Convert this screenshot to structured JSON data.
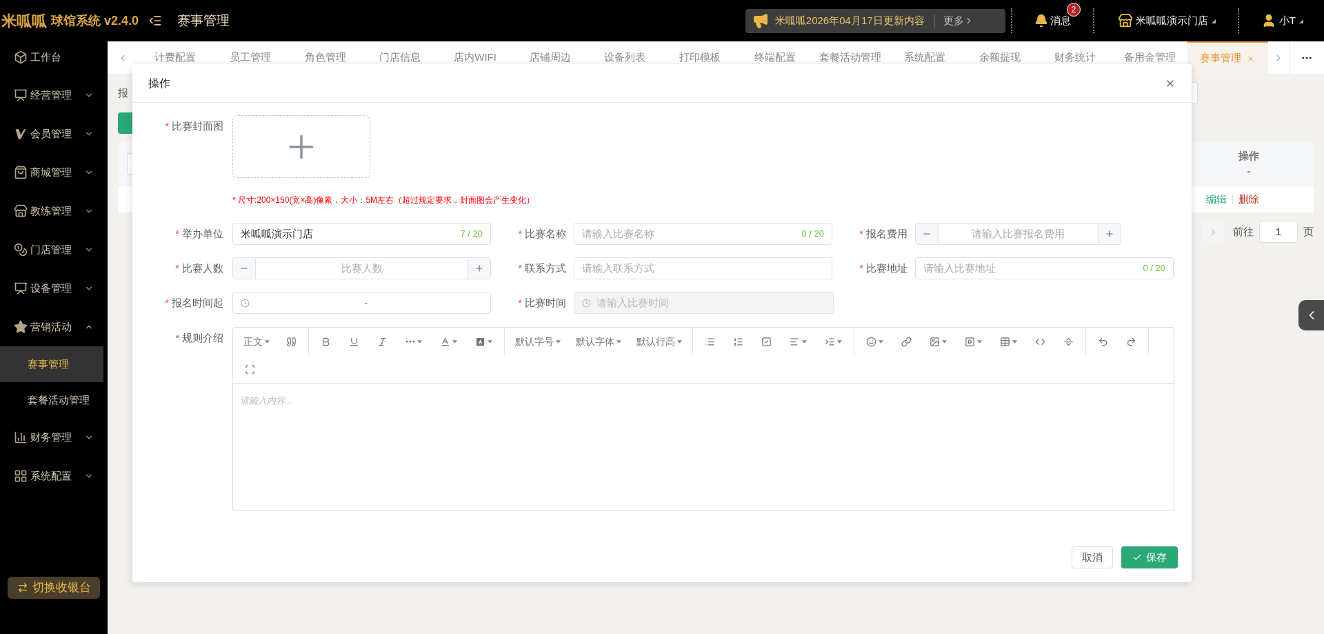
{
  "topbar": {
    "logo": "米呱呱",
    "app_name": "球馆系统 v2.4.0",
    "page_title": "赛事管理",
    "notice": {
      "text": "米呱呱2026年04月17日更新内容",
      "more": "更多"
    },
    "messages": {
      "label": "消息",
      "badge": "2"
    },
    "store": "米呱呱演示门店",
    "user": "小T"
  },
  "sidebar": {
    "items": [
      {
        "label": "工作台",
        "kind": "link",
        "selected": false
      },
      {
        "label": "经营管理",
        "kind": "group",
        "expanded": false
      },
      {
        "label": "会员管理",
        "kind": "group",
        "expanded": false
      },
      {
        "label": "商城管理",
        "kind": "group",
        "expanded": false
      },
      {
        "label": "教练管理",
        "kind": "group",
        "expanded": false
      },
      {
        "label": "门店管理",
        "kind": "group",
        "expanded": false
      },
      {
        "label": "设备管理",
        "kind": "group",
        "expanded": false
      },
      {
        "label": "营销活动",
        "kind": "group",
        "expanded": true,
        "children": [
          {
            "label": "赛事管理",
            "selected": true
          },
          {
            "label": "套餐活动管理",
            "selected": false
          }
        ]
      },
      {
        "label": "财务管理",
        "kind": "group",
        "expanded": false
      },
      {
        "label": "系统配置",
        "kind": "group",
        "expanded": false
      }
    ],
    "switch_button": "切换收银台"
  },
  "tabs": [
    {
      "label": "计费配置",
      "selected": false
    },
    {
      "label": "员工管理",
      "selected": false
    },
    {
      "label": "角色管理",
      "selected": false
    },
    {
      "label": "门店信息",
      "selected": false
    },
    {
      "label": "店内WIFI",
      "selected": false
    },
    {
      "label": "店铺周边",
      "selected": false
    },
    {
      "label": "设备列表",
      "selected": false
    },
    {
      "label": "打印模板",
      "selected": false
    },
    {
      "label": "终端配置",
      "selected": false
    },
    {
      "label": "套餐活动管理",
      "selected": false
    },
    {
      "label": "系统配置",
      "selected": false
    },
    {
      "label": "余额提现",
      "selected": false
    },
    {
      "label": "财务统计",
      "selected": false
    },
    {
      "label": "备用金管理",
      "selected": false
    },
    {
      "label": "赛事管理",
      "selected": true
    }
  ],
  "background": {
    "filter_label": "报",
    "table": {
      "column_title": "操作",
      "column_subtitle": "-",
      "actions": [
        {
          "label": "编辑",
          "color": "#2aa876"
        },
        {
          "label": "删除",
          "color": "#c0392b"
        }
      ]
    },
    "pagination": {
      "goto_label": "前往",
      "page": "1",
      "page_suffix": "页"
    }
  },
  "dialog": {
    "title": "操作",
    "required_mark": "*",
    "cover": {
      "label": "比赛封面图",
      "required": true,
      "hint": "* 尺寸:200×150(宽×高)像素，大小：5M左右（超过规定要求，封面图会产生变化）"
    },
    "field_rows": [
      [
        {
          "label": "举办单位",
          "required": true,
          "kind": "text",
          "value": "米呱呱演示门店",
          "counter": "7 / 20",
          "disabled": false
        },
        {
          "label": "比赛名称",
          "required": true,
          "kind": "text",
          "placeholder": "请输入比赛名称",
          "counter": "0 / 20",
          "disabled": false
        },
        {
          "label": "报名费用",
          "required": true,
          "kind": "number",
          "placeholder": "请输入比赛报名费用",
          "disabled": false
        }
      ],
      [
        {
          "label": "比赛人数",
          "required": true,
          "kind": "number",
          "placeholder": "比赛人数",
          "disabled": false
        },
        {
          "label": "联系方式",
          "required": true,
          "kind": "text",
          "placeholder": "请输入联系方式",
          "disabled": false
        },
        {
          "label": "比赛地址",
          "required": true,
          "kind": "text",
          "placeholder": "请输入比赛地址",
          "counter": "0 / 20",
          "disabled": false
        }
      ],
      [
        {
          "label": "报名时间起",
          "required": true,
          "kind": "daterange",
          "separator": "-",
          "disabled": false
        },
        {
          "label": "比赛时间",
          "required": true,
          "kind": "date",
          "placeholder": "请输入比赛时间",
          "disabled": true
        }
      ]
    ],
    "rules": {
      "label": "规则介绍",
      "required": true,
      "placeholder": "请输入内容...",
      "toolbar": [
        [
          {
            "label": "正文",
            "dropdown": true
          },
          {
            "dropdown": false
          }
        ],
        [
          {
            "dropdown": false
          },
          {
            "dropdown": false
          },
          {
            "dropdown": false
          },
          {
            "dropdown": true
          },
          {
            "dropdown": true
          },
          {
            "dropdown": true
          }
        ],
        [
          {
            "label": "默认字号",
            "dropdown": true
          },
          {
            "label": "默认字体",
            "dropdown": true
          },
          {
            "label": "默认行高",
            "dropdown": true
          }
        ],
        [
          {
            "dropdown": false
          },
          {
            "dropdown": false
          },
          {
            "dropdown": false
          },
          {
            "dropdown": true
          },
          {
            "dropdown": true
          }
        ],
        [
          {
            "dropdown": true
          },
          {
            "dropdown": false
          },
          {
            "dropdown": true
          },
          {
            "dropdown": true
          },
          {
            "dropdown": true
          },
          {
            "dropdown": false
          },
          {
            "dropdown": false
          }
        ],
        [
          {
            "dropdown": false
          },
          {
            "dropdown": false
          }
        ],
        [
          {
            "dropdown": false
          }
        ]
      ]
    },
    "buttons": [
      {
        "label": "取消",
        "kind": "cancel"
      },
      {
        "label": "保存",
        "kind": "primary"
      }
    ]
  }
}
